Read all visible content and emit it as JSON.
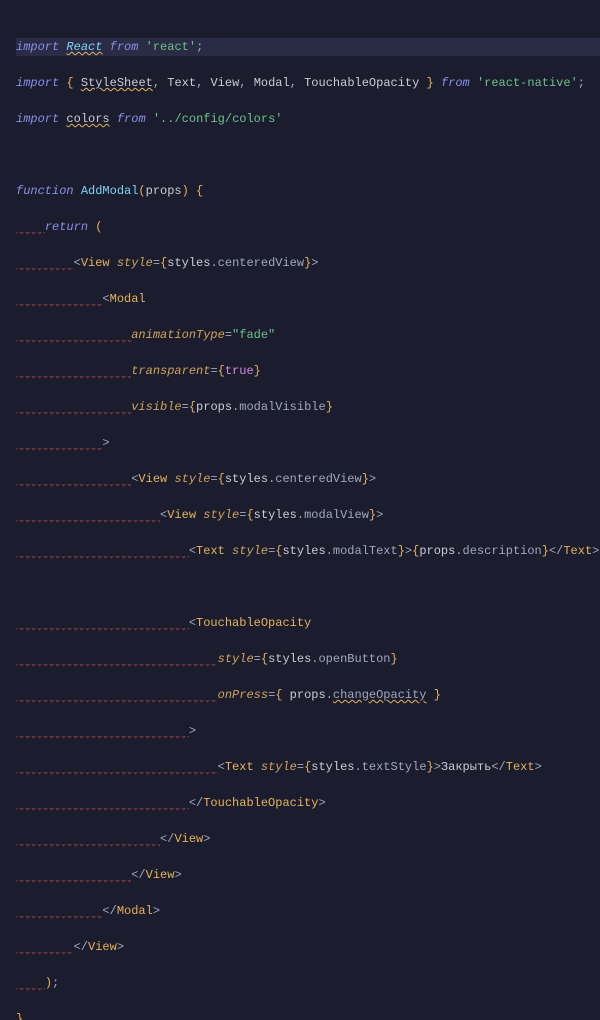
{
  "file": {
    "language": "javascript-react"
  },
  "tokens": {
    "kw_import": "import",
    "kw_from": "from",
    "kw_function": "function",
    "kw_return": "return",
    "id_React": "React",
    "id_StyleSheet": "StyleSheet",
    "id_Text": "Text",
    "id_View": "View",
    "id_Modal": "Modal",
    "id_TouchableOpacity": "TouchableOpacity",
    "id_colors": "colors",
    "str_react": "'react'",
    "str_react_native": "'react-native'",
    "str_colors_path": "'../config/colors'",
    "fn_name": "AddModal",
    "fn_param": "props",
    "attr_style": "style",
    "attr_animationType": "animationType",
    "attr_transparent": "transparent",
    "attr_visible": "visible",
    "attr_onPress": "onPress",
    "val_fade": "\"fade\"",
    "val_true": "true",
    "styles_obj": "styles",
    "prop_centeredView": "centeredView",
    "prop_modalView": "modalView",
    "prop_modalText": "modalText",
    "prop_openButton": "openButton",
    "prop_textStyle": "textStyle",
    "props_obj": "props",
    "prop_modalVisible": "modalVisible",
    "prop_description": "description",
    "prop_changeOpacity": "changeOpacity",
    "tag_View": "View",
    "tag_Modal": "Modal",
    "tag_Text": "Text",
    "tag_TouchableOpacity": "TouchableOpacity",
    "text_close": "Закрыть",
    "semi": ";",
    "comma": ", ",
    "lbrace": "{",
    "rbrace": "}",
    "lparen": "(",
    "rparen": ")",
    "lt": "<",
    "gt": ">",
    "ltclose": "</",
    "eq": "=",
    "dot": "."
  },
  "line_numbers": [
    "",
    "",
    "",
    "",
    "",
    "",
    "",
    "",
    "",
    "",
    "",
    "",
    "",
    "",
    "",
    "",
    "",
    "",
    "",
    "",
    "",
    "",
    "",
    "",
    "",
    "",
    "",
    ""
  ]
}
